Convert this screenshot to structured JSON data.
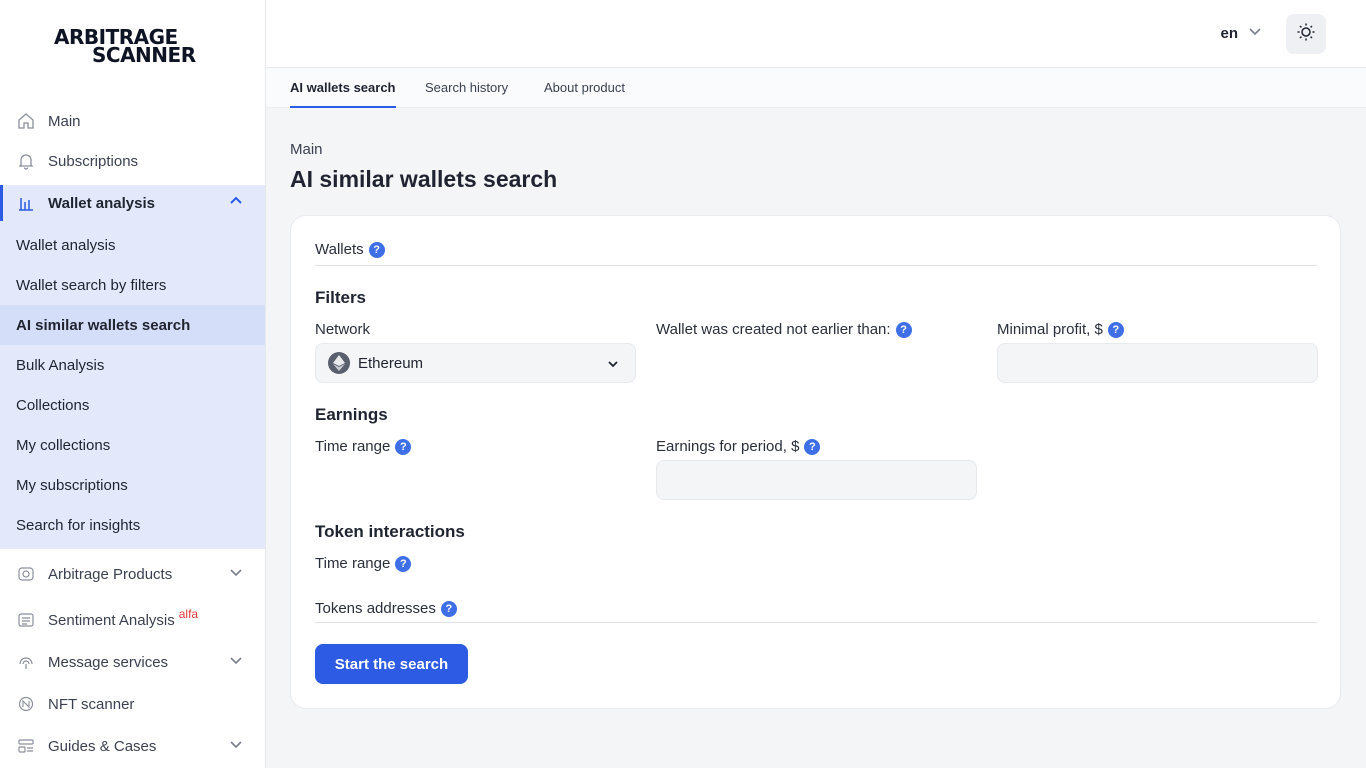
{
  "logo": {
    "line1": "ARBITRAGE",
    "line2": "SCANNER"
  },
  "sidebar": {
    "items": [
      {
        "label": "Main",
        "icon": "home-icon"
      },
      {
        "label": "Subscriptions",
        "icon": "bell-icon"
      },
      {
        "label": "Wallet analysis",
        "icon": "chart-icon",
        "expanded": true
      }
    ],
    "sub_items": [
      {
        "label": "Wallet analysis"
      },
      {
        "label": "Wallet search by filters"
      },
      {
        "label": "AI similar wallets search",
        "current": true
      },
      {
        "label": "Bulk Analysis"
      },
      {
        "label": "Collections"
      },
      {
        "label": "My collections"
      },
      {
        "label": "My subscriptions"
      },
      {
        "label": "Search for insights"
      }
    ],
    "bottom_items": [
      {
        "label": "Arbitrage Products",
        "icon": "eye-icon",
        "has_children": true
      },
      {
        "label": "Sentiment Analysis",
        "badge": "alfa",
        "icon": "newspaper-icon"
      },
      {
        "label": "Message services",
        "icon": "broadcast-icon",
        "has_children": true
      },
      {
        "label": "NFT scanner",
        "icon": "nft-icon"
      },
      {
        "label": "Guides & Cases",
        "icon": "guides-icon",
        "has_children": true
      }
    ]
  },
  "header": {
    "language": "en",
    "theme_icon": "sun-icon"
  },
  "tabs": [
    {
      "label": "AI wallets search",
      "active": true
    },
    {
      "label": "Search history"
    },
    {
      "label": "About product"
    }
  ],
  "breadcrumb": "Main",
  "page_title": "AI similar wallets search",
  "form": {
    "wallets_label": "Wallets",
    "filters_title": "Filters",
    "network_label": "Network",
    "network_value": "Ethereum",
    "created_label": "Wallet was created not earlier than:",
    "min_profit_label": "Minimal profit, $",
    "min_profit_value": "",
    "earnings_title": "Earnings",
    "earnings_time_label": "Time range",
    "earnings_period_label": "Earnings for period, $",
    "earnings_period_value": "",
    "token_title": "Token interactions",
    "token_time_label": "Time range",
    "tokens_addresses_label": "Tokens addresses",
    "help_glyph": "?",
    "submit_label": "Start the search"
  },
  "colors": {
    "accent": "#2d5be3",
    "help": "#3e6fe6",
    "active_bg": "#e3e9fb",
    "badge": "#e23b3b"
  }
}
